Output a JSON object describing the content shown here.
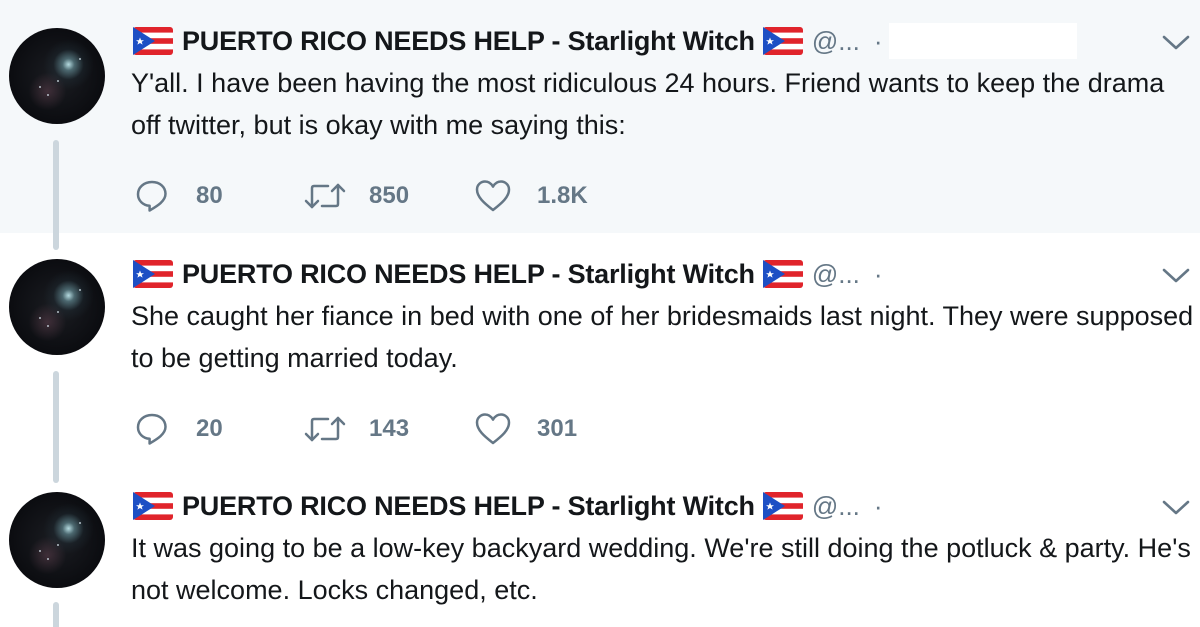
{
  "tweets": [
    {
      "name": "PUERTO RICO NEEDS HELP - Starlight Witch",
      "handle": "@...",
      "separator": "·",
      "text": "Y'all. I have been having the most ridiculous 24 hours. Friend wants to keep the drama off twitter, but is okay with me saying this:",
      "replies": "80",
      "retweets": "850",
      "likes": "1.8K",
      "highlighted": true
    },
    {
      "name": "PUERTO RICO NEEDS HELP - Starlight Witch",
      "handle": "@...",
      "separator": "·",
      "text": "She caught her fiance in bed with one of her bridesmaids last night. They were supposed to be getting married today.",
      "replies": "20",
      "retweets": "143",
      "likes": "301",
      "highlighted": false
    },
    {
      "name": "PUERTO RICO NEEDS HELP - Starlight Witch",
      "handle": "@...",
      "separator": "·",
      "text": "It was going to be a low-key backyard wedding. We're still doing the potluck & party. He's not welcome. Locks changed, etc.",
      "highlighted": false
    }
  ],
  "icons": {
    "reply": "speech-bubble-icon",
    "retweet": "retweet-arrows-icon",
    "like": "heart-icon",
    "menu": "chevron-down-icon",
    "flag": "puerto-rico-flag-icon"
  },
  "colors": {
    "highlight_bg": "#f5f8fa",
    "text": "#14171a",
    "secondary": "#657786",
    "thread_line": "#ccd6dd",
    "flag_red": "#e0242b",
    "flag_blue": "#1d4fc4"
  }
}
